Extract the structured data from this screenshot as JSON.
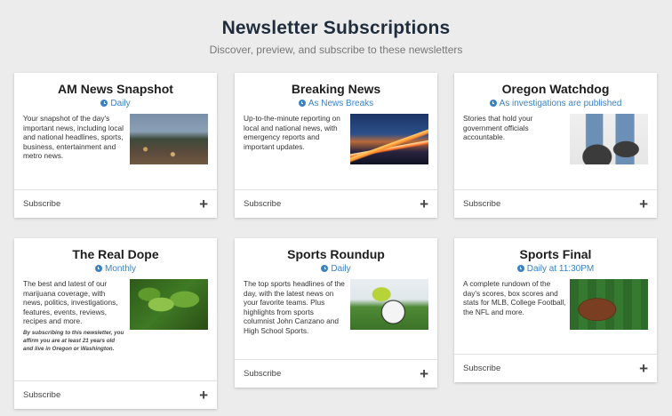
{
  "header": {
    "title": "Newsletter Subscriptions",
    "subtitle": "Discover, preview, and subscribe to these newsletters"
  },
  "cards": [
    {
      "title": "AM News Snapshot",
      "frequency": "Daily",
      "description": "Your snapshot of the day's important news, including local and national headlines, sports, business, entertainment and metro news.",
      "image": "city-skyline-image",
      "subscribe_label": "Subscribe"
    },
    {
      "title": "Breaking News",
      "frequency": "As News Breaks",
      "description": "Up-to-the-minute reporting on local and national news, with emergency reports and important updates.",
      "image": "highway-night-image",
      "subscribe_label": "Subscribe"
    },
    {
      "title": "Oregon Watchdog",
      "frequency": "As investigations are published",
      "description": "Stories that hold your government officials accountable.",
      "image": "shoes-image",
      "subscribe_label": "Subscribe"
    },
    {
      "title": "The Real Dope",
      "frequency": "Monthly",
      "description": "The best and latest of our marijuana coverage, with news, politics, investigations, features, events, reviews, recipes and more.",
      "disclaimer": "By subscribing to this newsletter, you affirm you are at least 21 years old and live in Oregon or Washington.",
      "image": "cannabis-leaf-image",
      "subscribe_label": "Subscribe"
    },
    {
      "title": "Sports Roundup",
      "frequency": "Daily",
      "description": "The top sports headlines of the day, with the latest news on your favorite teams. Plus highlights from sports columnist John Canzano and High School Sports.",
      "image": "soccer-ball-image",
      "subscribe_label": "Subscribe"
    },
    {
      "title": "Sports Final",
      "frequency": "Daily at 11:30PM",
      "description": "A complete rundown of the day's scores, box scores and stats for MLB, College Football, the NFL and more.",
      "image": "football-image",
      "subscribe_label": "Subscribe"
    }
  ],
  "colors": {
    "accent": "#3a82c4",
    "background": "#ececec",
    "card": "#ffffff"
  },
  "icons": {
    "frequency": "clock-icon",
    "subscribe": "plus-icon"
  }
}
